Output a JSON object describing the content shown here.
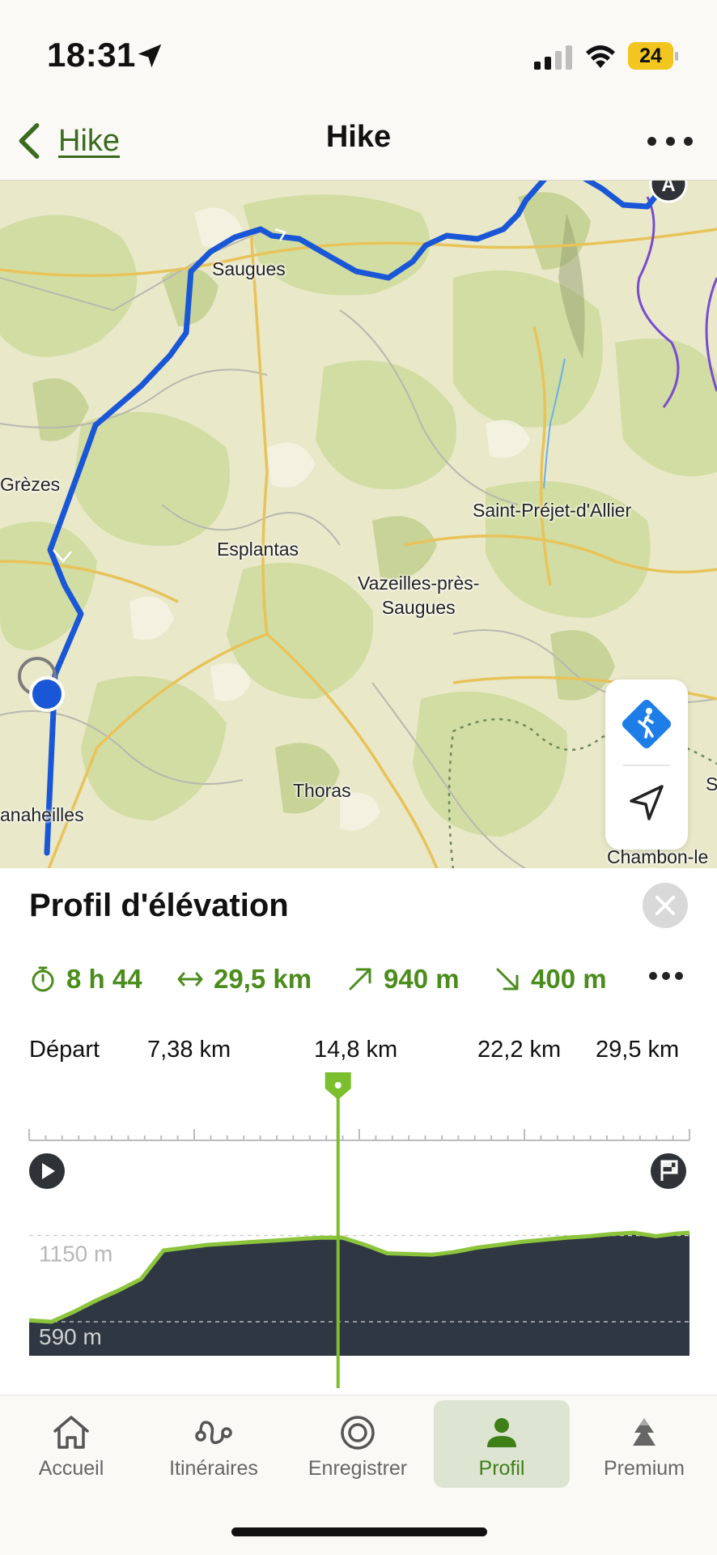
{
  "status_bar": {
    "time": "18:31",
    "battery": "24"
  },
  "nav": {
    "back_label": "Hike",
    "title": "Hike"
  },
  "map": {
    "places": [
      "Saugues",
      "Grèzes",
      "Esplantas",
      "Saint-Préjet-d'Allier",
      "Vazeilles-près-\nSaugues",
      "Thoras",
      "anaheilles",
      "Chambon-le",
      "S"
    ],
    "start_marker": "A"
  },
  "elevation": {
    "title": "Profil d'élévation",
    "stats": {
      "duration": "8 h 44",
      "distance": "29,5 km",
      "ascent": "940 m",
      "descent": "400 m"
    },
    "axis_labels": [
      "Départ",
      "7,38 km",
      "14,8 km",
      "22,2 km",
      "29,5 km"
    ],
    "y_labels": [
      "1150 m",
      "590 m"
    ]
  },
  "chart_data": {
    "type": "area",
    "title": "Profil d'élévation",
    "xlabel": "",
    "ylabel": "",
    "x_unit": "km",
    "y_unit": "m",
    "x": [
      0,
      1,
      2,
      3,
      4,
      5,
      6,
      7,
      8,
      9,
      10,
      11,
      12,
      13,
      14,
      15,
      16,
      17,
      18,
      19,
      20,
      21,
      22,
      23,
      24,
      25,
      26,
      27,
      28,
      29,
      29.5
    ],
    "series": [
      {
        "values": [
          600,
          590,
          660,
          740,
          810,
          890,
          1090,
          1110,
          1130,
          1140,
          1150,
          1160,
          1170,
          1180,
          1180,
          1130,
          1070,
          1065,
          1060,
          1080,
          1110,
          1130,
          1150,
          1165,
          1180,
          1190,
          1205,
          1215,
          1190,
          1210,
          1215
        ]
      }
    ],
    "xlim": [
      0,
      29.5
    ],
    "y_ticks": [
      590,
      1150
    ],
    "cursor_km": 13.8
  },
  "tabs": [
    {
      "label": "Accueil",
      "icon": "home-icon"
    },
    {
      "label": "Itinéraires",
      "icon": "route-icon"
    },
    {
      "label": "Enregistrer",
      "icon": "record-icon"
    },
    {
      "label": "Profil",
      "icon": "profile-icon",
      "active": true
    },
    {
      "label": "Premium",
      "icon": "premium-icon"
    }
  ],
  "colors": {
    "accent": "#4b8d1d",
    "route": "#1a57d6",
    "elevation_fill": "#2f3742"
  }
}
